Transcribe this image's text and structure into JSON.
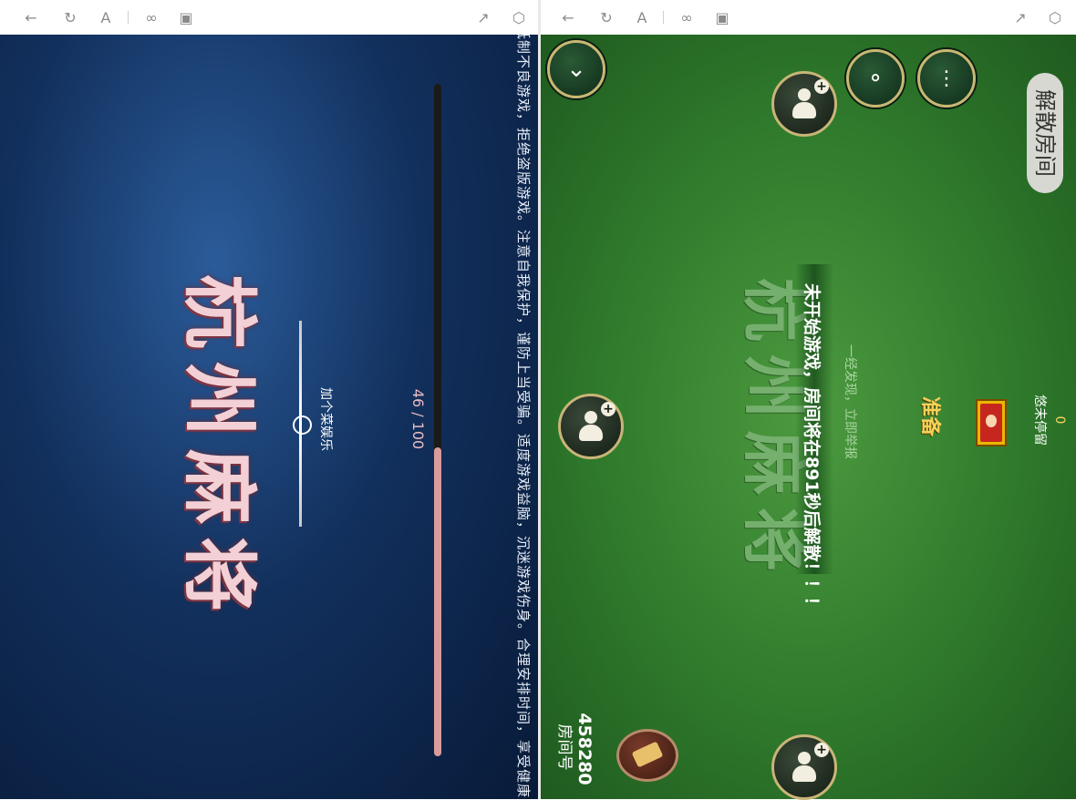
{
  "loading": {
    "title_chars": "杭州麻将",
    "tagline": "加个菜娱乐",
    "progress_text": "46 / 100",
    "progress": 0.46,
    "notice": "抵制不良游戏，拒绝盗版游戏。注意自我保护，谨防上当受骗。适度游戏益脑，沉迷游戏伤身。合理安排时间，享受健康生活。"
  },
  "game": {
    "title_chars": "杭州麻将",
    "room_label": "房间号",
    "room_number": "458280",
    "dissolve_label": "解散房间",
    "warning": "未开始游戏，房间将在891秒后解散！！！",
    "rules_line1": "一经发现，立即举报",
    "rules_line2": "",
    "ready_label": "准备",
    "player_name": "悠未停留",
    "player_score": "0",
    "invite_label": "邀请"
  },
  "colors": {
    "loading_bg": "#12305d",
    "table_bg": "#2f7a2c",
    "progress_fill": "#d99b9b",
    "button_border": "#c9b774"
  },
  "icons": [
    "back-icon",
    "refresh-icon",
    "font-icon",
    "link-icon",
    "window-icon",
    "share-icon",
    "cube-icon",
    "chevron-down-icon",
    "microphone-icon",
    "chat-icon",
    "invite-icon",
    "ticket-icon"
  ]
}
